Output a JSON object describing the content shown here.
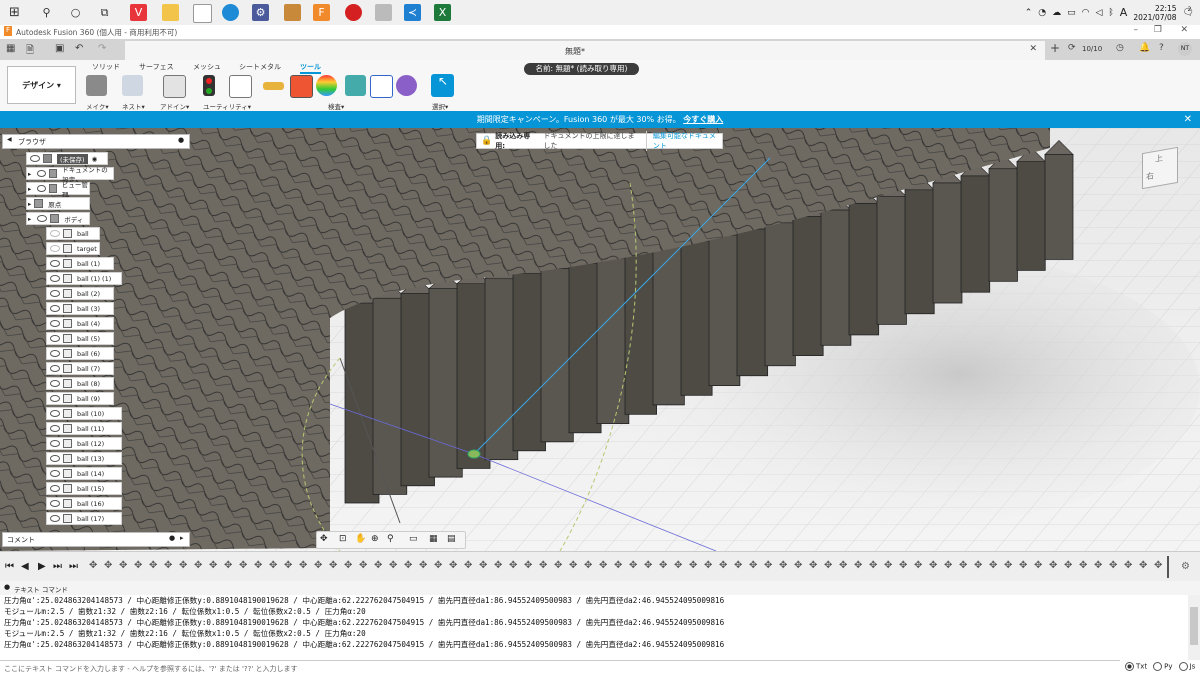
{
  "taskbar": {
    "time": "22:15",
    "date": "2021/07/08",
    "ime": "A",
    "notifications": "2"
  },
  "window": {
    "title": "Autodesk Fusion 360 (個人用 - 商用利用不可)"
  },
  "doc_tab": {
    "label": "無題*",
    "count": "10/10",
    "user": "NT"
  },
  "toolbar": {
    "tabs": [
      "ソリッド",
      "サーフェス",
      "メッシュ",
      "シートメタル",
      "ツール"
    ],
    "active_tab": "ツール",
    "design_label": "デザイン",
    "doc_name": "名前: 無題* (読み取り専用)",
    "groups": [
      "メイク",
      "ネスト",
      "アドイン",
      "ユーティリティ",
      "検査",
      "選択"
    ]
  },
  "promo": {
    "text": "期間限定キャンペーン。Fusion 360 が最大 30% お得。",
    "link": "今すぐ購入"
  },
  "readonly": {
    "label": "読み込み専用:",
    "message": "ドキュメントの上限に達しました",
    "link": "編集可能なドキュメント"
  },
  "browser": {
    "title": "ブラウザ",
    "root": "(未保存)",
    "items": [
      "ドキュメントの設定",
      "ビュー管理",
      "原点",
      "ボディ"
    ],
    "bodies": [
      "ball",
      "target",
      "ball (1)",
      "ball (1) (1)",
      "ball (2)",
      "ball (3)",
      "ball (4)",
      "ball (5)",
      "ball (6)",
      "ball (7)",
      "ball (8)",
      "ball (9)",
      "ball (10)",
      "ball (11)",
      "ball (12)",
      "ball (13)",
      "ball (14)",
      "ball (15)",
      "ball (16)",
      "ball (17)"
    ]
  },
  "comment": {
    "label": "コメント"
  },
  "viewcube": {
    "top": "上",
    "right": "右"
  },
  "text_command": {
    "title": "テキスト コマンド",
    "lines": [
      "圧力角α':25.024863204148573 / 中心距離修正係数y:0.8891048190019628 / 中心距離a:62.222762047504915 / 歯先円直径da1:86.94552409500983 / 歯先円直径da2:46.945524095009816",
      "モジュールm:2.5 / 歯数z1:32 / 歯数z2:16 / 転位係数x1:0.5 / 転位係数x2:0.5 / 圧力角α:20",
      "圧力角α':25.024863204148573 / 中心距離修正係数y:0.8891048190019628 / 中心距離a:62.222762047504915 / 歯先円直径da1:86.94552409500983 / 歯先円直径da2:46.945524095009816",
      "モジュールm:2.5 / 歯数z1:32 / 歯数z2:16 / 転位係数x1:0.5 / 転位係数x2:0.5 / 圧力角α:20",
      "圧力角α':25.024863204148573 / 中心距離修正係数y:0.8891048190019628 / 中心距離a:62.222762047504915 / 歯先円直径da1:86.94552409500983 / 歯先円直径da2:46.945524095009816"
    ],
    "placeholder": "ここにテキスト コマンドを入力します - ヘルプを参照するには、'?' または '??' と入力します",
    "modes": [
      "Txt",
      "Py",
      "Js"
    ]
  },
  "colors": {
    "accent": "#0696d7",
    "gear": "#5a5650",
    "gear_top": "#6b665f",
    "record": "#1a1a1a"
  }
}
